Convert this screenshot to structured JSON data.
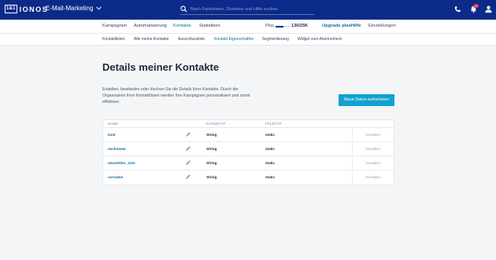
{
  "header": {
    "logo_box": "1&1",
    "logo_text": "IONOS",
    "product": "E-Mail-Marketing",
    "search_placeholder": "Nach Funktionen, Domains und Hilfe suchen",
    "notification_count": "20"
  },
  "nav1": {
    "items": [
      "Kampagnen",
      "Automatisierung",
      "Kontakte",
      "Statistiken"
    ],
    "active": "Kontakte",
    "plan_label": "Plus",
    "plan_progress": 0.54,
    "counter": "136/25K",
    "upgrade": "Upgrade plan",
    "help": "Hilfe",
    "settings": "Einstellungen"
  },
  "nav2": {
    "items": [
      "Kontaktlisten",
      "Alle meine Kontakte",
      "Ausschlussliste",
      "Kontakt-Eigenschaften",
      "Segmentierung",
      "Widget zum Abonnement"
    ],
    "active": "Kontakt-Eigenschaften"
  },
  "main": {
    "title": "Details meiner Kontakte",
    "description": "Erstellen, bearbeiten oder löschen Sie die Details Ihrer Kontakte. Durch die Organisation Ihrer Kontaktlisten werden Ihre Kampagnen personalisiert und somit effektiver.",
    "new_button": "Neue Daten aufnehmen"
  },
  "table": {
    "headers": [
      "NAME",
      "DATENTYP",
      "FELDTYP"
    ],
    "rows": [
      {
        "name": "land",
        "type": "String",
        "field": "static",
        "action": "Verwalten"
      },
      {
        "name": "nachname",
        "type": "String",
        "field": "static",
        "action": "Verwalten"
      },
      {
        "name": "newsletter_anm",
        "type": "String",
        "field": "static",
        "action": "Verwalten"
      },
      {
        "name": "vorname",
        "type": "String",
        "field": "static",
        "action": "Verwalten"
      }
    ]
  },
  "colors": {
    "header_bg": "#0b2a8a",
    "accent": "#0b6fa6",
    "button": "#11a2cf",
    "badge": "#e0283e"
  }
}
